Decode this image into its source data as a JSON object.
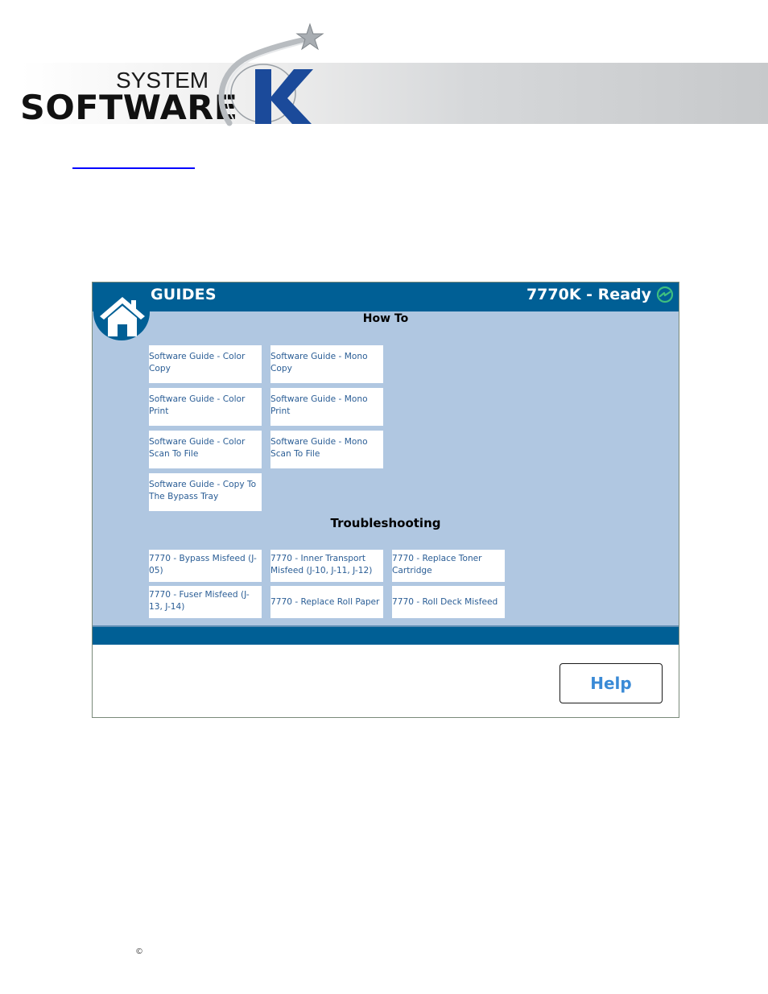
{
  "logo": {
    "line1": "SYSTEM",
    "line2": "SOFTWARE",
    "letter": "K",
    "brand_color": "#1b4a9a"
  },
  "app": {
    "title": "GUIDES",
    "status": "7770K - Ready",
    "status_icon": "ready-icon",
    "colors": {
      "header": "#005f95",
      "content_bg": "#b0c7e1",
      "tile_text": "#2a5d95",
      "status_icon": "#3fbf7f",
      "help_text": "#3a8ad6"
    },
    "sections": {
      "how_to": {
        "title": "How To",
        "items": [
          "Software Guide - Color Copy",
          "Software Guide - Mono Copy",
          "Software Guide - Color Print",
          "Software Guide - Mono Print",
          "Software Guide - Color Scan To File",
          "Software Guide - Mono Scan To File",
          "Software Guide - Copy To The Bypass Tray"
        ]
      },
      "troubleshooting": {
        "title": "Troubleshooting",
        "items": [
          "7770 - Bypass Misfeed (J-05)",
          "7770 - Inner Transport Misfeed (J-10, J-11, J-12)",
          "7770 - Replace Toner Cartridge",
          "7770 - Fuser Misfeed (J-13, J-14)",
          "7770 - Replace Roll Paper",
          "7770 - Roll Deck Misfeed"
        ]
      }
    },
    "help_label": "Help"
  },
  "footer": {
    "copyright_symbol": "©"
  }
}
